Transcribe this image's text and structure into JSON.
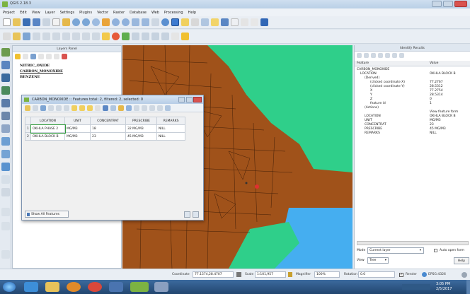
{
  "window": {
    "title": "QGIS 2.18.3"
  },
  "menu": [
    "Project",
    "Edit",
    "View",
    "Layer",
    "Settings",
    "Plugins",
    "Vector",
    "Raster",
    "Database",
    "Web",
    "Processing",
    "Help"
  ],
  "layers_panel": {
    "title": "Layers Panel",
    "layers": [
      "NITRIC_OXIDE",
      "CARBON_MONOXIDE",
      "BENZENE"
    ]
  },
  "attribute_table": {
    "title": "CARBON_MONOXIDE :: Features total: 2, filtered: 2, selected: 0",
    "columns": [
      "LOCATION",
      "UNIT",
      "CONCENTRAT",
      "PRESCRIBE",
      "REMARKS"
    ],
    "rows": [
      {
        "index": "1",
        "cells": [
          "OKHLA PHASE 2",
          "MG/M3",
          "18",
          "32 MG/M3",
          "NILL"
        ]
      },
      {
        "index": "2",
        "cells": [
          "OKHLA BLOCK B",
          "MG/M3",
          "23",
          "45 MG/M3",
          "NILL"
        ]
      }
    ],
    "show_all": "Show All Features"
  },
  "identify": {
    "title": "Identify Results",
    "headers": [
      "Feature",
      "Value"
    ],
    "tree": [
      {
        "label": "CARBON_MONOXIDE",
        "value": ""
      },
      {
        "label": "LOCATION",
        "value": "OKHLA BLOCK B"
      },
      {
        "label": "(Derived)",
        "value": ""
      },
      {
        "label": "(clicked coordinate X)",
        "value": "77.2767"
      },
      {
        "label": "(clicked coordinate Y)",
        "value": "28.5312"
      },
      {
        "label": "X",
        "value": "77.2754"
      },
      {
        "label": "Y",
        "value": "28.5314"
      },
      {
        "label": "Z",
        "value": "0"
      },
      {
        "label": "feature id",
        "value": "1"
      },
      {
        "label": "(Actions)",
        "value": ""
      },
      {
        "label": "",
        "value": "View feature form"
      },
      {
        "label": "LOCATION",
        "value": "OKHLA BLOCK B"
      },
      {
        "label": "UNIT",
        "value": "MG/M3"
      },
      {
        "label": "CONCENTRAT",
        "value": "23"
      },
      {
        "label": "PRESCRIBE",
        "value": "45 MG/M3"
      },
      {
        "label": "REMARKS",
        "value": "NILL"
      }
    ],
    "mode_label": "Mode",
    "mode_value": "Current layer",
    "auto_open": "Auto open form",
    "view_label": "View",
    "view_value": "Tree",
    "help": "Help"
  },
  "status": {
    "coordinate_label": "Coordinate",
    "coordinate_value": "77.1574,28.4707",
    "scale_label": "Scale",
    "scale_value": "1:101,957",
    "magnifier_label": "Magnifier",
    "magnifier_value": "100%",
    "rotation_label": "Rotation",
    "rotation_value": "0.0",
    "render_label": "Render",
    "crs_label": "EPSG:4326"
  },
  "clock": {
    "time": "3:05 PM",
    "date": "2/5/2017"
  }
}
